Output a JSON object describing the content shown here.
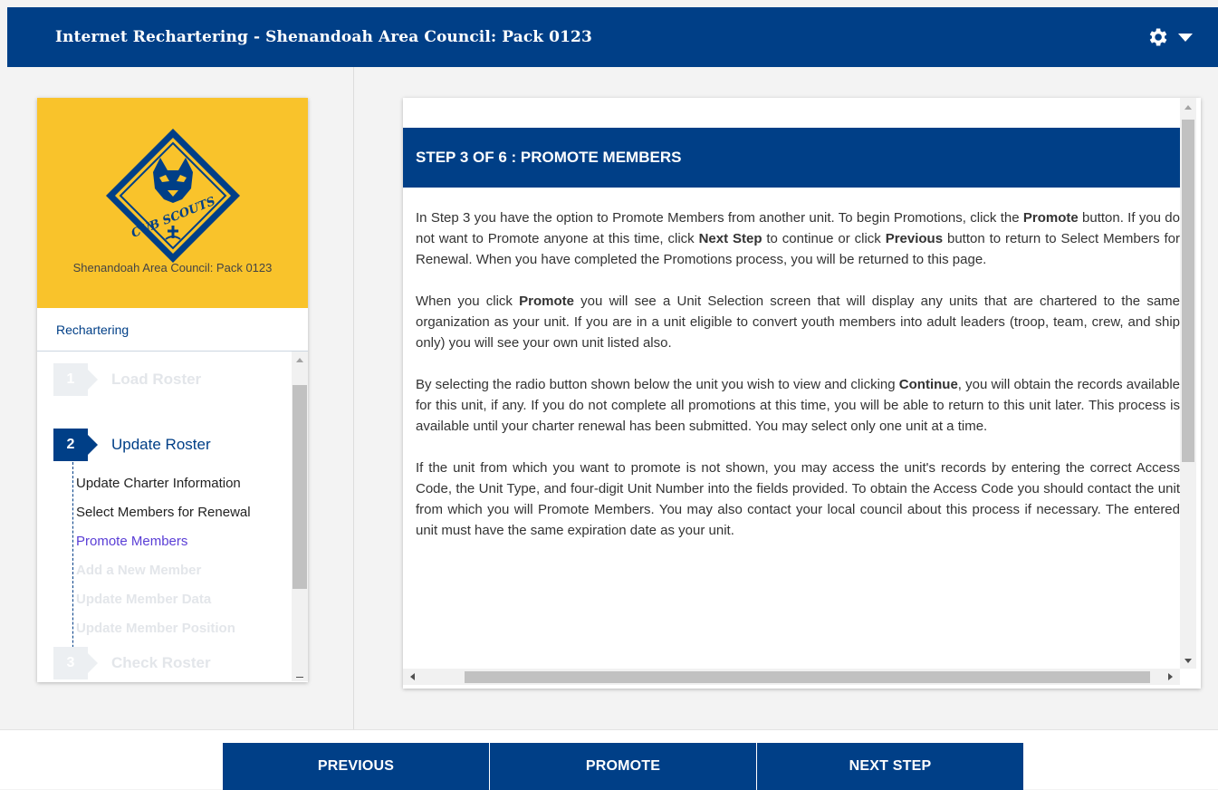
{
  "header": {
    "title": "Internet Rechartering - Shenandoah Area Council: Pack 0123",
    "settings_icon": "gear-icon",
    "menu_icon": "caret-down-icon"
  },
  "colors": {
    "brand": "#003f87",
    "card_gold": "#f9c32b",
    "current_substep": "#5a3ed6"
  },
  "sidebar": {
    "logo": "cub-scouts-logo",
    "logo_text": "CUB SCOUTS",
    "unit_name": "Shenandoah Area Council: Pack 0123",
    "section_label": "Rechartering",
    "steps": [
      {
        "number": "1",
        "label": "Load Roster",
        "state": "inactive"
      },
      {
        "number": "2",
        "label": "Update Roster",
        "state": "active"
      },
      {
        "number": "3",
        "label": "Check Roster",
        "state": "inactive"
      }
    ],
    "substeps": [
      {
        "label": "Update Charter Information",
        "state": "done"
      },
      {
        "label": "Select Members for Renewal",
        "state": "done"
      },
      {
        "label": "Promote Members",
        "state": "current"
      },
      {
        "label": "Add a New Member",
        "state": "future"
      },
      {
        "label": "Update Member Data",
        "state": "future"
      },
      {
        "label": "Update Member Position",
        "state": "future"
      }
    ]
  },
  "main": {
    "banner": "STEP 3 OF 6 : PROMOTE MEMBERS",
    "p1": {
      "a": "In Step 3 you have the option to Promote Members from another unit. To begin Promotions, click the ",
      "b": "Promote",
      "c": " button. If you do not want to Promote anyone at this time, click ",
      "d": "Next Step",
      "e": " to continue or click ",
      "f": "Previous",
      "g": " button to return to Select Members for Renewal. When you have completed the Promotions process, you will be returned to this page."
    },
    "p2": {
      "a": "When you click ",
      "b": "Promote",
      "c": " you will see a Unit Selection screen that will display any units that are chartered to the same organization as your unit. If you are in a unit eligible to convert youth members into adult leaders (troop, team, crew, and ship only) you will see your own unit listed also."
    },
    "p3": {
      "a": "By selecting the radio button shown below the unit you wish to view and clicking ",
      "b": "Continue",
      "c": ", you will obtain the records available for this unit, if any. If you do not complete all promotions at this time, you will be able to return to this unit later. This process is available until your charter renewal has been submitted. You may select only one unit at a time."
    },
    "p4": "If the unit from which you want to promote is not shown, you may access the unit's records by entering the correct Access Code, the Unit Type, and four-digit Unit Number into the fields provided. To obtain the Access Code you should contact the unit from which you will Promote Members. You may also contact your local council about this process if necessary. The entered unit must have the same expiration date as your unit."
  },
  "footer": {
    "previous_label": "PREVIOUS",
    "promote_label": "PROMOTE",
    "next_label": "NEXT STEP"
  }
}
